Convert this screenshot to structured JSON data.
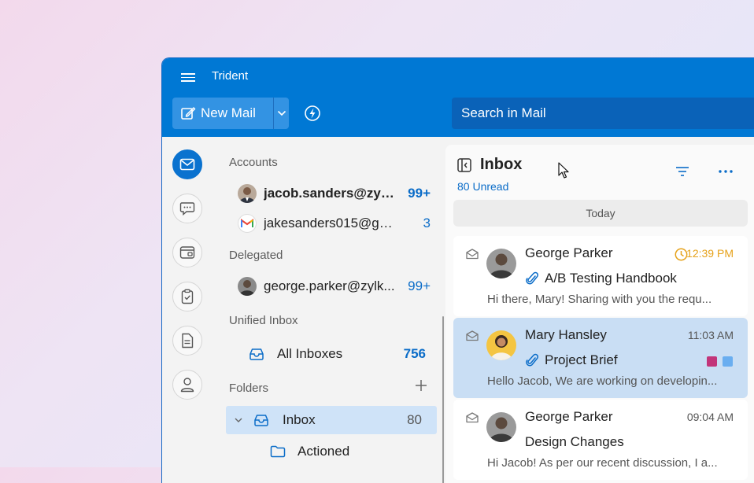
{
  "app": {
    "title": "Trident"
  },
  "toolbar": {
    "new_mail_label": "New Mail",
    "search_placeholder": "Search in Mail"
  },
  "rail": {
    "items": [
      "mail",
      "chat",
      "calendar",
      "tasks",
      "notes",
      "contacts"
    ],
    "active": "mail",
    "accent": "#0a72cf"
  },
  "accounts": {
    "header": "Accounts",
    "items": [
      {
        "name": "jacob.sanders@zylk...",
        "count": "99+",
        "bold": true
      },
      {
        "name": "jakesanders015@gm...",
        "count": "3",
        "bold": false
      }
    ]
  },
  "delegated": {
    "header": "Delegated",
    "items": [
      {
        "name": "george.parker@zylk...",
        "count": "99+"
      }
    ]
  },
  "unified": {
    "header": "Unified Inbox",
    "all_inboxes_label": "All Inboxes",
    "all_inboxes_count": "756"
  },
  "folders": {
    "header": "Folders",
    "items": [
      {
        "label": "Inbox",
        "count": "80",
        "selected": true
      },
      {
        "label": "Actioned",
        "count": "",
        "selected": false
      }
    ]
  },
  "list": {
    "title": "Inbox",
    "unread": "80 Unread",
    "group": "Today",
    "mails": [
      {
        "sender": "George Parker",
        "time": "12:39 PM",
        "subject": "A/B Testing Handbook",
        "preview": "Hi there, Mary! Sharing with you the requ...",
        "attachment": true,
        "reminder": true,
        "selected": false
      },
      {
        "sender": "Mary Hansley",
        "time": "11:03 AM",
        "subject": "Project Brief",
        "preview": "Hello Jacob, We are working on developin...",
        "attachment": true,
        "reminder": false,
        "selected": true,
        "tags": [
          "#c2357a",
          "#6aaef0"
        ]
      },
      {
        "sender": "George Parker",
        "time": "09:04 AM",
        "subject": "Design Changes",
        "preview": "Hi Jacob! As per our recent discussion, I a...",
        "attachment": false,
        "reminder": false,
        "selected": false
      }
    ]
  },
  "colors": {
    "brand": "#0078d4",
    "count_blue": "#0a6cc8",
    "reminder": "#e6a21b"
  }
}
